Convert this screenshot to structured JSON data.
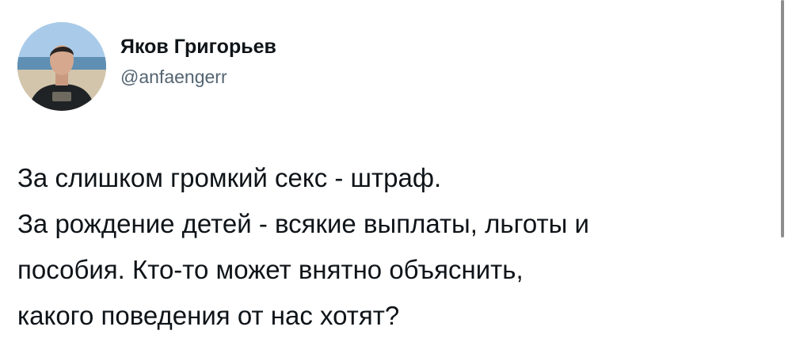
{
  "author": {
    "display_name": "Яков Григорьев",
    "handle": "@anfaengerr"
  },
  "tweet": {
    "lines": [
      "За слишком громкий секс - штраф.",
      "За рождение детей - всякие выплаты, льготы и",
      "пособия. Кто-то может внятно объяснить,",
      "какого поведения от нас хотят?"
    ]
  },
  "icons": {
    "avatar": "profile-photo"
  },
  "colors": {
    "text": "#0f1419",
    "secondary": "#536471",
    "background": "#ffffff"
  }
}
